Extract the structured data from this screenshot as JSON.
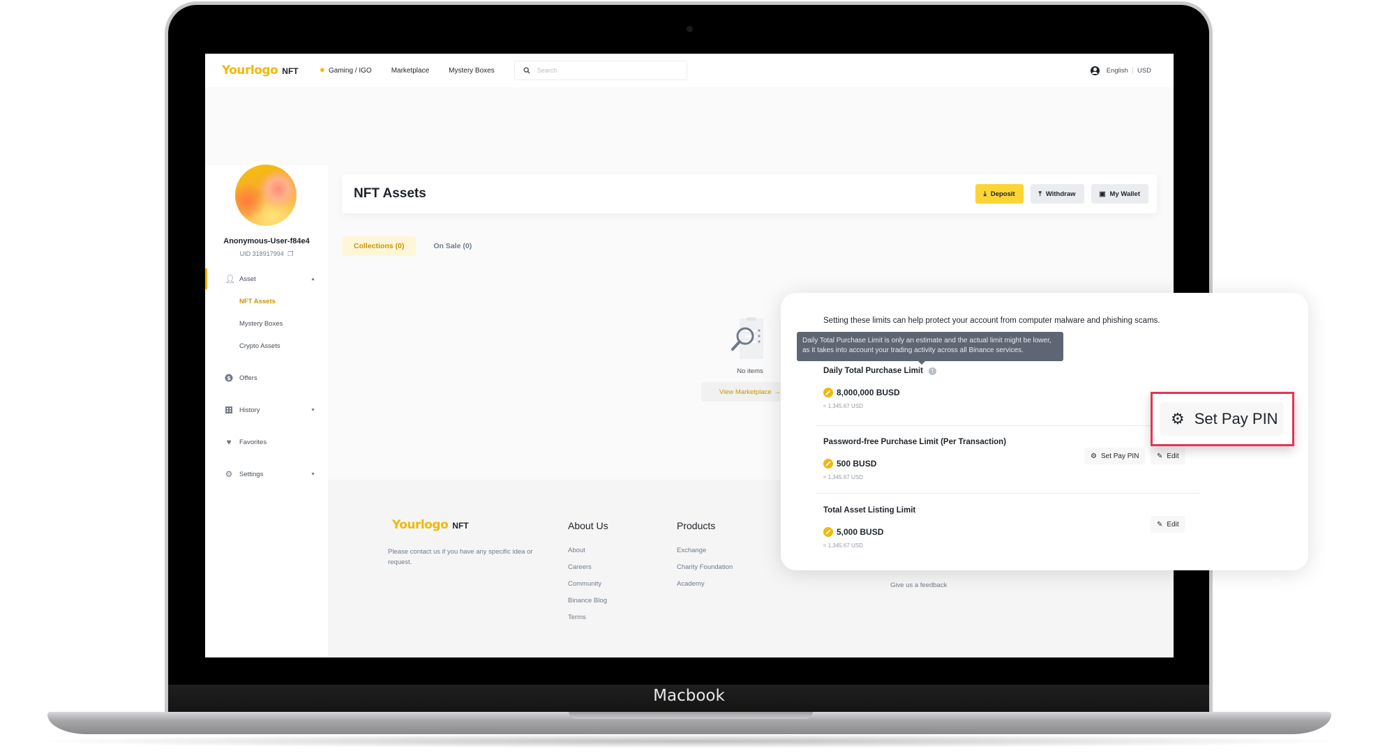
{
  "device": {
    "label": "Macbook"
  },
  "topbar": {
    "logo": "Yourlogo",
    "logo_suffix": "NFT",
    "nav": [
      {
        "label": "Gaming / IGO",
        "icon": "flame-icon"
      },
      {
        "label": "Marketplace"
      },
      {
        "label": "Mystery Boxes"
      }
    ],
    "search_placeholder": "Search",
    "language": "English",
    "currency": "USD"
  },
  "sidebar": {
    "username": "Anonymous-User-f84e4",
    "uid": "UID 318917994",
    "items": [
      {
        "label": "Asset",
        "icon": "user-icon",
        "expanded": true
      },
      {
        "label": "Offers",
        "icon": "dollar-icon"
      },
      {
        "label": "History",
        "icon": "receipt-icon",
        "expanded": false
      },
      {
        "label": "Favorites",
        "icon": "heart-icon"
      },
      {
        "label": "Settings",
        "icon": "gear-icon",
        "expanded": false
      }
    ],
    "asset_sub": [
      "NFT Assets",
      "Mystery Boxes",
      "Crypto Assets"
    ],
    "active_sub": "NFT Assets"
  },
  "main": {
    "title": "NFT Assets",
    "buttons": {
      "deposit": "Deposit",
      "withdraw": "Withdraw",
      "wallet": "My Wallet"
    },
    "tabs": [
      "Collections (0)",
      "On Sale (0)"
    ],
    "active_tab": 0,
    "empty_text": "No items",
    "view_marketplace": "View Marketplace"
  },
  "footer": {
    "logo": "Yourlogo",
    "logo_suffix": "NFT",
    "description": "Please contact us if you have any specific idea or request.",
    "about": {
      "heading": "About Us",
      "links": [
        "About",
        "Careers",
        "Community",
        "Binance Blog",
        "Terms"
      ]
    },
    "products": {
      "heading": "Products",
      "links": [
        "Exchange",
        "Charity Foundation",
        "Academy"
      ]
    },
    "feedback": "Give us a feedback"
  },
  "popup": {
    "intro": "Setting these limits can help protect your account from computer malware and phishing scams.",
    "tooltip": "Daily Total Purchase Limit is only an estimate and the actual limit might be lower, as it takes into account your trading activity across all Binance services.",
    "limits": [
      {
        "title": "Daily Total Purchase Limit",
        "value": "8,000,000 BUSD",
        "usd": "≈ 1,345.67 USD"
      },
      {
        "title": "Password-free Purchase Limit (Per Transaction)",
        "value": "500 BUSD",
        "usd": "≈ 1,345.67 USD"
      },
      {
        "title": "Total Asset Listing Limit",
        "value": "5,000 BUSD",
        "usd": "≈ 1,345.67 USD"
      }
    ],
    "set_pin": "Set Pay PIN",
    "edit": "Edit"
  },
  "highlight": {
    "label": "Set Pay PIN",
    "color": "#e8334f"
  },
  "colors": {
    "brand": "#f0b90b",
    "button_primary": "#fcd535",
    "active_text": "#c99400"
  }
}
